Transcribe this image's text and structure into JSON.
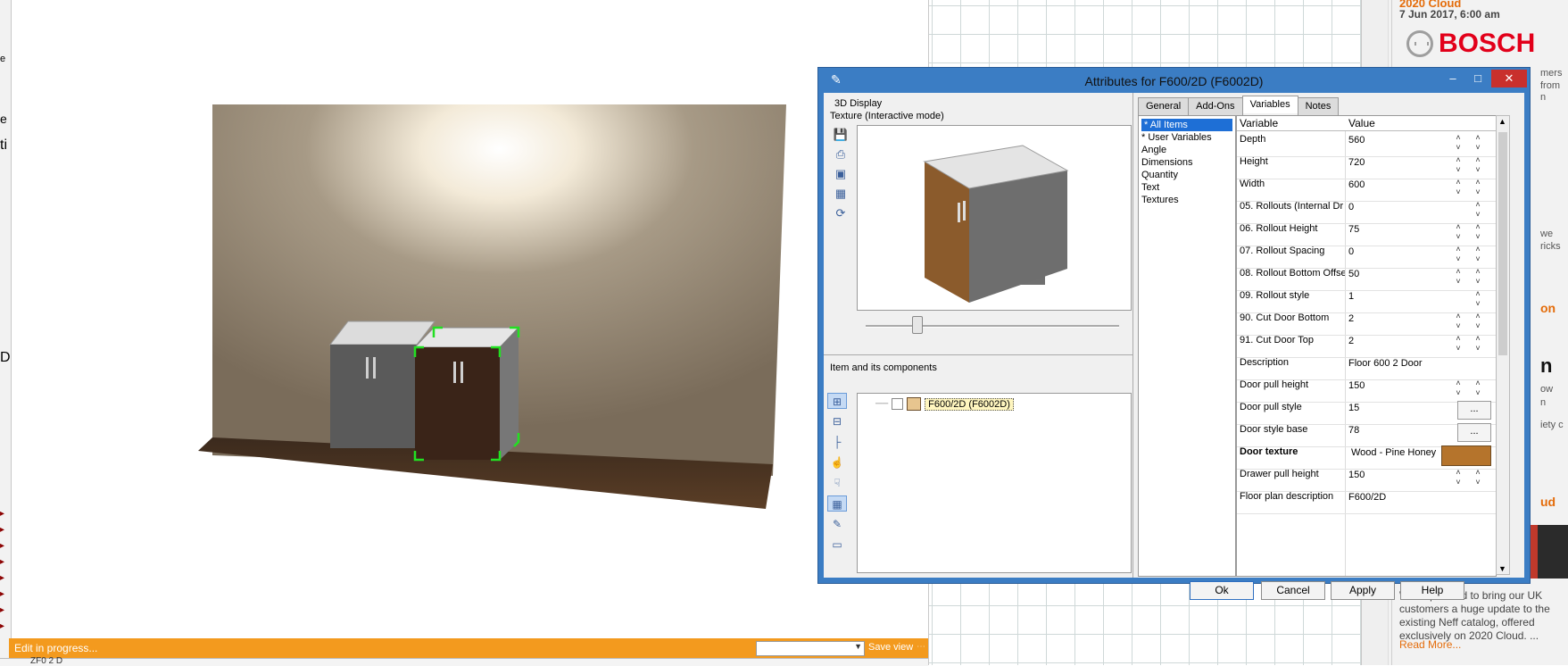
{
  "viewport": {
    "status": "Edit in progress...",
    "save_view": "Save view",
    "bottom_label": "ZF0 2 D"
  },
  "news": {
    "header": "2020 Cloud",
    "date": "7 Jun 2017, 6:00 am",
    "brand": "BOSCH",
    "body": "We're pleased to bring our UK customers a huge update to the existing Neff catalog, offered exclusively on 2020 Cloud. ...",
    "read_more": "Read More..."
  },
  "dialog": {
    "title": "Attributes for F600/2D (F6002D)",
    "display_label": "3D Display",
    "texture_mode": "Texture (Interactive mode)",
    "components_label": "Item and its components",
    "tree_item": "F600/2D (F6002D)",
    "tabs": [
      {
        "label": "General"
      },
      {
        "label": "Add-Ons"
      },
      {
        "label": "Variables"
      },
      {
        "label": "Notes"
      }
    ],
    "categories": [
      {
        "label": "* All Items"
      },
      {
        "label": "* User Variables"
      },
      {
        "label": "Angle"
      },
      {
        "label": "Dimensions"
      },
      {
        "label": "Quantity"
      },
      {
        "label": "Text"
      },
      {
        "label": "Textures"
      }
    ],
    "grid_headers": {
      "variable": "Variable",
      "value": "Value"
    },
    "rows": [
      {
        "name": "Depth",
        "value": "560"
      },
      {
        "name": "Height",
        "value": "720"
      },
      {
        "name": "Width",
        "value": "600"
      },
      {
        "name": "05. Rollouts (Internal Dr",
        "value": "0"
      },
      {
        "name": "06. Rollout Height",
        "value": "75"
      },
      {
        "name": "07. Rollout Spacing",
        "value": "0"
      },
      {
        "name": "08. Rollout Bottom Offse",
        "value": "50"
      },
      {
        "name": "09. Rollout style",
        "value": "1"
      },
      {
        "name": "90. Cut Door Bottom",
        "value": "2"
      },
      {
        "name": "91. Cut Door Top",
        "value": "2"
      },
      {
        "name": "Description",
        "value": "Floor 600 2 Door"
      },
      {
        "name": "Door pull height",
        "value": "150"
      },
      {
        "name": "Door pull style",
        "value": "15"
      },
      {
        "name": "Door style base",
        "value": "78"
      },
      {
        "name": "Door texture",
        "value": "Wood - Pine Honey"
      },
      {
        "name": "Drawer pull height",
        "value": "150"
      },
      {
        "name": "Floor plan description",
        "value": "F600/2D"
      }
    ],
    "buttons": {
      "ok": "Ok",
      "cancel": "Cancel",
      "apply": "Apply",
      "help": "Help"
    },
    "ellipsis": "...",
    "texture_color": "#b5742c"
  },
  "side_fragments": {
    "f1": "mers",
    "f2": "from",
    "f3": "n",
    "f4": "we",
    "f5": "ricks",
    "f6": "on",
    "f7": "n",
    "f8": "ow",
    "f9": "n",
    "f10": "iety c",
    "f11": "ud"
  },
  "left_strip": {
    "l1": "ti",
    "l2": "D",
    "l3": "e"
  },
  "colors": {
    "accent_orange": "#f39a1e",
    "dialog_blue": "#3b7dc4",
    "bosch_red": "#e2001a"
  }
}
